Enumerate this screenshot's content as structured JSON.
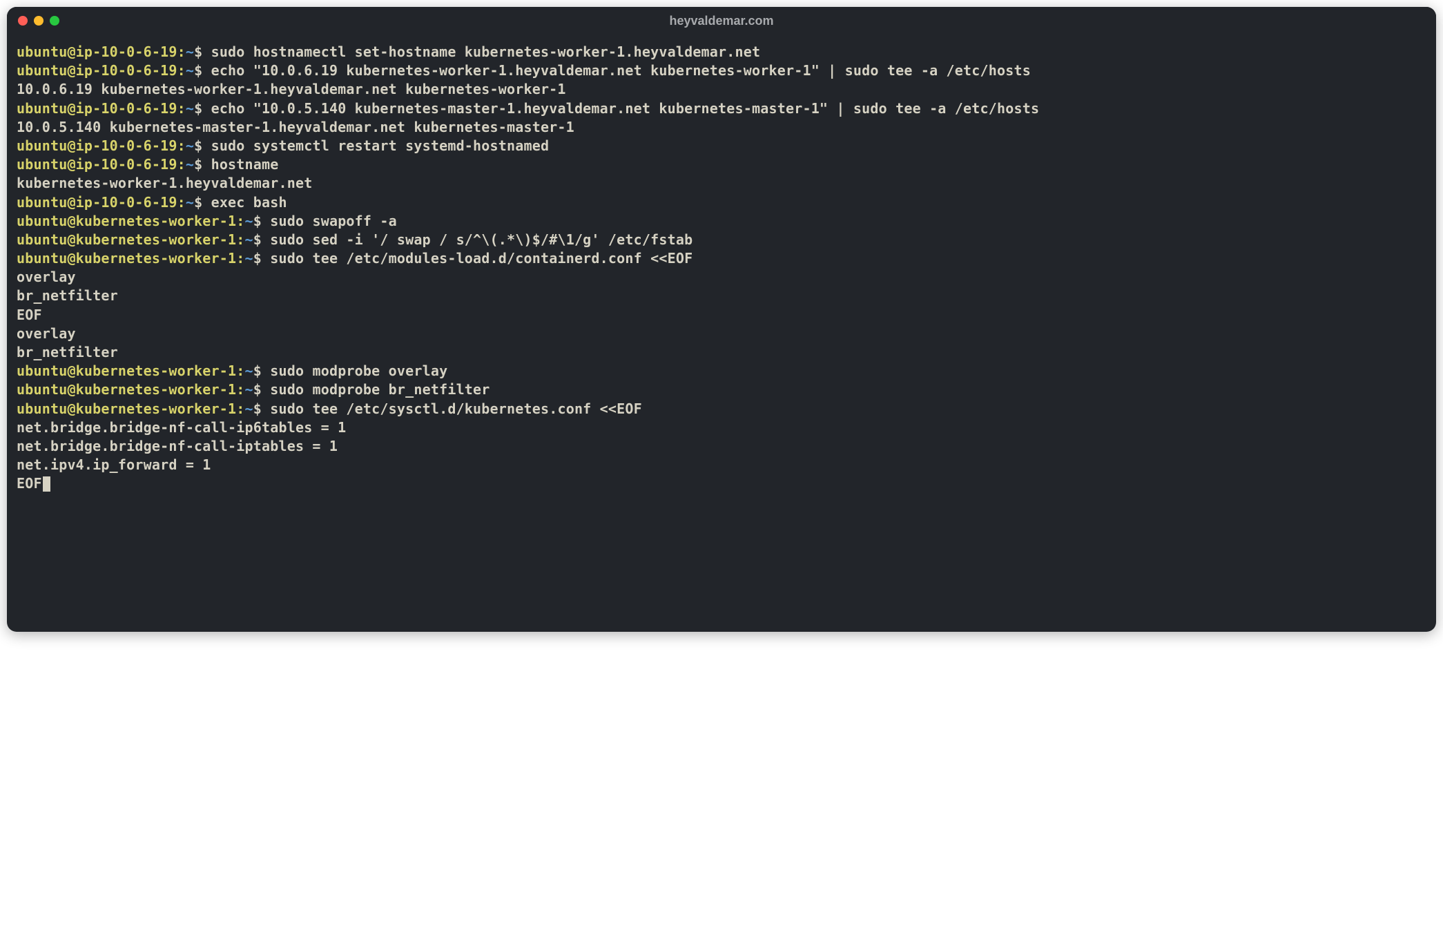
{
  "window": {
    "title": "heyvaldemar.com"
  },
  "prompts": {
    "p1": "ubuntu@ip-10-0-6-19",
    "p2": "ubuntu@kubernetes-worker-1",
    "sep": ":",
    "path": "~",
    "sigil": "$ "
  },
  "lines": {
    "cmd1": "sudo hostnamectl set-hostname kubernetes-worker-1.heyvaldemar.net",
    "cmd2": "echo \"10.0.6.19 kubernetes-worker-1.heyvaldemar.net kubernetes-worker-1\" | sudo tee -a /etc/hosts",
    "out2": "10.0.6.19 kubernetes-worker-1.heyvaldemar.net kubernetes-worker-1",
    "cmd3": "echo \"10.0.5.140 kubernetes-master-1.heyvaldemar.net kubernetes-master-1\" | sudo tee -a /etc/hosts",
    "out3": "10.0.5.140 kubernetes-master-1.heyvaldemar.net kubernetes-master-1",
    "cmd4": "sudo systemctl restart systemd-hostnamed",
    "cmd5": "hostname",
    "out5": "kubernetes-worker-1.heyvaldemar.net",
    "cmd6": "exec bash",
    "cmd7": "sudo swapoff -a",
    "cmd8": "sudo sed -i '/ swap / s/^\\(.*\\)$/#\\1/g' /etc/fstab",
    "cmd9": "sudo tee /etc/modules-load.d/containerd.conf <<EOF",
    "in9a": "overlay",
    "in9b": "br_netfilter",
    "in9c": "EOF",
    "out9a": "overlay",
    "out9b": "br_netfilter",
    "cmd10": "sudo modprobe overlay",
    "cmd11": "sudo modprobe br_netfilter",
    "cmd12": "sudo tee /etc/sysctl.d/kubernetes.conf <<EOF",
    "in12a": "net.bridge.bridge-nf-call-ip6tables = 1",
    "in12b": "net.bridge.bridge-nf-call-iptables = 1",
    "in12c": "net.ipv4.ip_forward = 1",
    "in12d": "EOF"
  }
}
